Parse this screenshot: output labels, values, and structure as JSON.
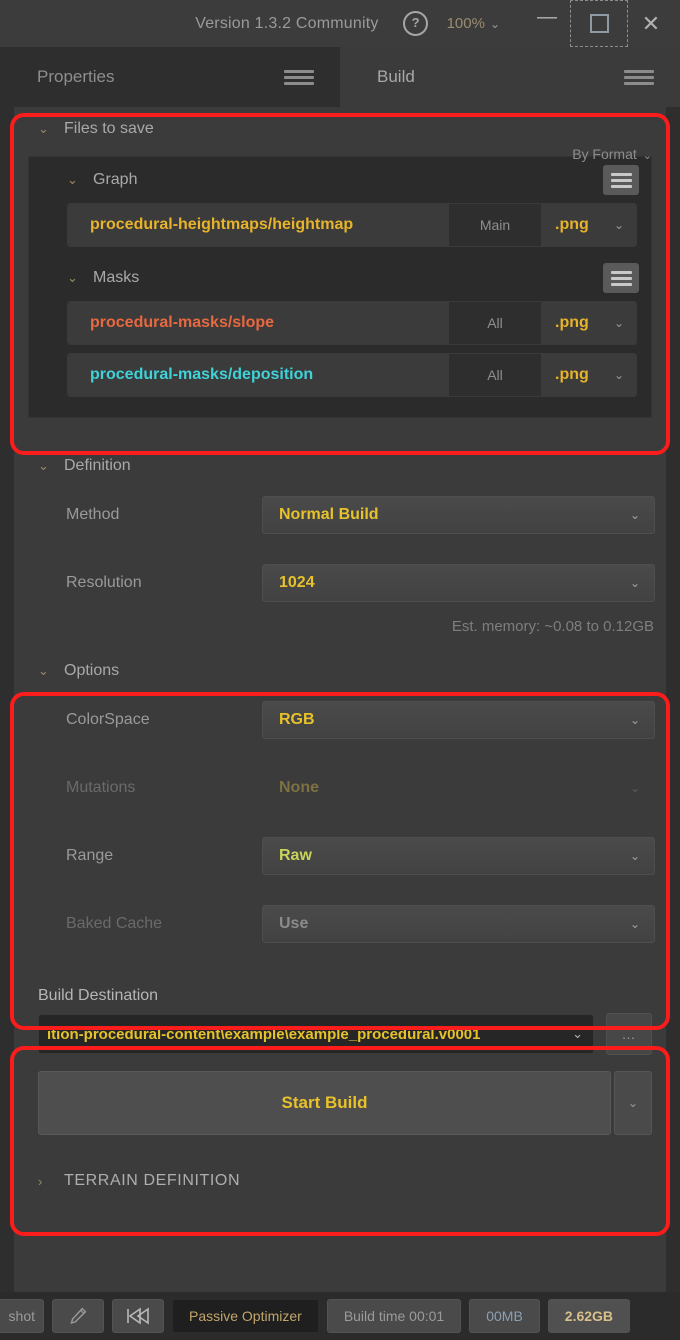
{
  "titlebar": {
    "version": "Version 1.3.2 Community",
    "help_icon": "help-circle-icon",
    "help_glyph": "?",
    "zoom": "100%",
    "chevron": "⌄",
    "minimize": "—",
    "maximize_icon": "maximize-square-icon",
    "close": "✕"
  },
  "tabs": [
    {
      "label": "Properties",
      "active": false
    },
    {
      "label": "Build",
      "active": true
    }
  ],
  "files_to_save": {
    "title": "Files to save",
    "caret": "⌄",
    "grouping": "By Format",
    "grouping_chevron": "⌄",
    "groups": [
      {
        "name": "Graph",
        "caret": "⌄",
        "rows": [
          {
            "name": "procedural-heightmaps/heightmap",
            "scope": "Main",
            "format": ".png",
            "chevron": "⌄",
            "color": "#e7b32a"
          }
        ]
      },
      {
        "name": "Masks",
        "caret": "⌄",
        "rows": [
          {
            "name": "procedural-masks/slope",
            "scope": "All",
            "format": ".png",
            "chevron": "⌄",
            "color": "#e8683f"
          },
          {
            "name": "procedural-masks/deposition",
            "scope": "All",
            "format": ".png",
            "chevron": "⌄",
            "color": "#3fd2d8"
          }
        ]
      }
    ]
  },
  "definition": {
    "title": "Definition",
    "caret": "⌄",
    "method_label": "Method",
    "method_value": "Normal Build",
    "resolution_label": "Resolution",
    "resolution_value": "1024",
    "est_memory": "Est. memory:  ~0.08 to 0.12GB",
    "chevron": "⌄"
  },
  "options": {
    "title": "Options",
    "caret": "⌄",
    "colorspace_label": "ColorSpace",
    "colorspace_value": "RGB",
    "mutations_label": "Mutations",
    "mutations_value": "None",
    "range_label": "Range",
    "range_value": "Raw",
    "baked_cache_label": "Baked Cache",
    "baked_cache_value": "Use",
    "chevron": "⌄"
  },
  "build_destination": {
    "title": "Build Destination",
    "path": "ition-procedural-content\\example\\example_procedural.v0001",
    "path_chevron": "⌄",
    "browse_label": "…",
    "start_build_label": "Start Build",
    "more_chevron": "⌄"
  },
  "terrain_definition": {
    "title": "TERRAIN DEFINITION",
    "caret": "›"
  },
  "statusbar": {
    "shot_label": "shot",
    "pen_icon": "pen-icon",
    "fastforward_icon": "fast-forward-icon",
    "optimizer_label": "Passive Optimizer",
    "build_time": "Build time 00:01",
    "memory": "00MB",
    "total_memory": "2.62GB"
  },
  "colors": {
    "accent_yellow": "#e7c22a",
    "annotation_red": "#fb1c1c",
    "panel_bg": "#3b3b3b",
    "window_bg": "#2e2e2e",
    "inner_bg": "#2b2b2b"
  }
}
